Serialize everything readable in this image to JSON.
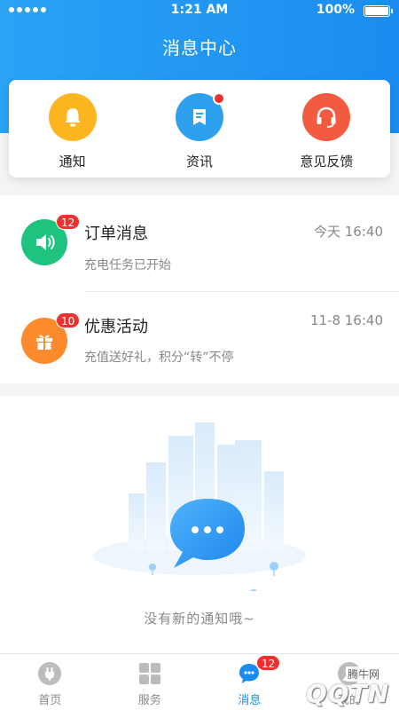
{
  "status_bar": {
    "time": "1:21 AM",
    "battery": "100%"
  },
  "header": {
    "title": "消息中心"
  },
  "quick_actions": [
    {
      "label": "通知",
      "icon": "bell-icon",
      "color": "#fdb61f"
    },
    {
      "label": "资讯",
      "icon": "bookmark-doc-icon",
      "color": "#2fa0ee",
      "has_dot": true
    },
    {
      "label": "意见反馈",
      "icon": "headset-icon",
      "color": "#f25b3f"
    }
  ],
  "messages": [
    {
      "title": "订单消息",
      "subtitle": "充电任务已开始",
      "time": "今天 16:40",
      "badge": "12",
      "icon": "speaker-icon",
      "color": "#1dc37e"
    },
    {
      "title": "优惠活动",
      "subtitle": "充值送好礼，积分“转”不停",
      "time": "11-8 16:40",
      "badge": "10",
      "icon": "gift-icon",
      "color": "#fd8a2b"
    }
  ],
  "empty_state": {
    "text": "没有新的通知哦~",
    "icon": "chat-bubble-icon"
  },
  "tabbar": {
    "items": [
      {
        "label": "首页",
        "icon": "plug-icon"
      },
      {
        "label": "服务",
        "icon": "grid-icon"
      },
      {
        "label": "消息",
        "icon": "message-icon",
        "badge": "12",
        "active": true
      },
      {
        "label": "我的",
        "icon": "user-icon"
      }
    ]
  },
  "watermark": {
    "brand": "腾牛网",
    "text": "QQTN"
  },
  "colors": {
    "primary": "#1a8cf0",
    "badge": "#f0302f",
    "text_secondary": "#888888"
  }
}
